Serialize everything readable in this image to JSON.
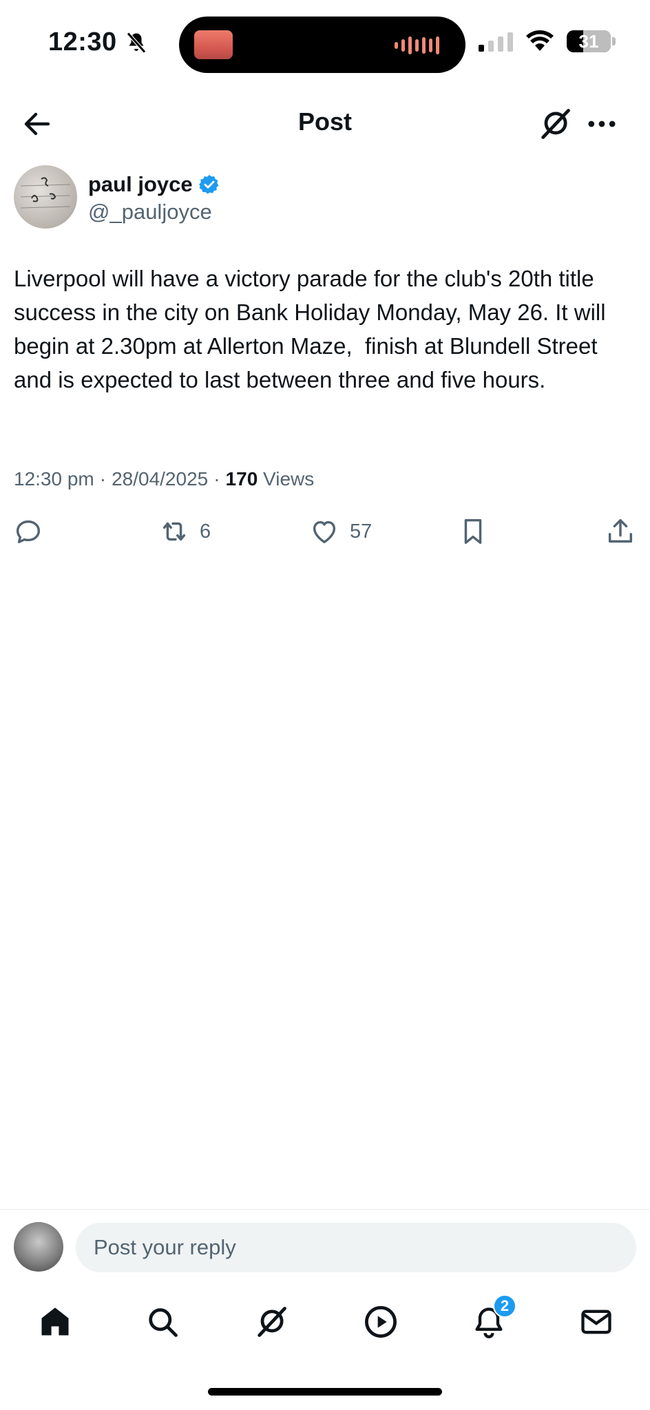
{
  "status_bar": {
    "time": "12:30",
    "battery_level": "31"
  },
  "header": {
    "title": "Post"
  },
  "post": {
    "author_name": "paul joyce",
    "author_handle": "@_pauljoyce",
    "verified": true,
    "text": "Liverpool will have a victory parade for the club's 20th title success in the city on Bank Holiday Monday, May 26. It will begin at 2.30pm at Allerton Maze,  finish at Blundell Street and is expected to last between three and five hours.",
    "time": "12:30 pm",
    "date": "28/04/2025",
    "views_count": "170",
    "views_label": "Views",
    "separator": "·",
    "retweets": "6",
    "likes": "57"
  },
  "reply": {
    "placeholder": "Post your reply"
  },
  "bottom_nav": {
    "notifications_badge": "2"
  },
  "colors": {
    "accent": "#1d9bf0",
    "text_primary": "#0f1419",
    "text_secondary": "#536471"
  },
  "icons": {
    "back": "arrow-left-icon",
    "grok": "grok-icon",
    "more": "more-horizontal-icon",
    "verified": "verified-badge-icon",
    "reply": "reply-icon",
    "retweet": "retweet-icon",
    "like": "heart-icon",
    "bookmark": "bookmark-icon",
    "share": "share-icon",
    "home": "home-icon",
    "search": "search-icon",
    "video": "play-icon",
    "notifications": "bell-icon",
    "messages": "mail-icon"
  }
}
